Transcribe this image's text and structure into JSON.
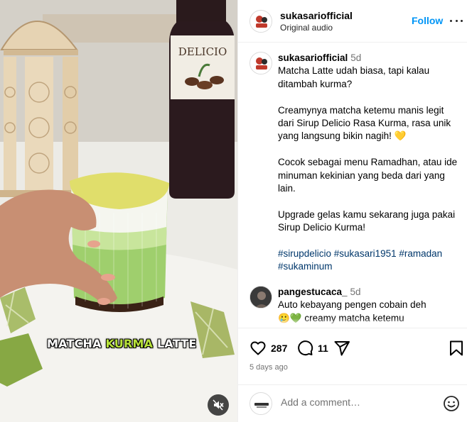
{
  "media": {
    "caption_prefix": "MATCHA",
    "caption_highlight": "KURMA",
    "caption_suffix": "LATTE",
    "bottle_label": "DELICIO",
    "mute_icon": "speaker-muted-icon"
  },
  "header": {
    "username": "sukasariofficial",
    "audio": "Original audio",
    "follow_label": "Follow",
    "more_icon": "more-horizontal-icon"
  },
  "caption": {
    "username": "sukasariofficial",
    "time": "5d",
    "lines": [
      "Matcha Latte udah biasa, tapi kalau ditambah kurma?",
      "Creamynya matcha ketemu manis legit dari Sirup Delicio Rasa Kurma, rasa unik yang langsung bikin nagih! 💛",
      "Cocok sebagai menu Ramadhan, atau ide minuman kekinian yang beda dari yang lain.",
      "Upgrade gelas kamu sekarang juga pakai Sirup Delicio Kurma!"
    ],
    "hashtags": "#sirupdelicio #sukasari1951 #ramadan #sukaminum"
  },
  "comment": {
    "username": "pangestucaca_",
    "time": "5d",
    "text": "Auto kebayang pengen cobain deh",
    "text2": "🥲💚 creamy matcha ketemu"
  },
  "actions": {
    "like_count": "287",
    "comment_count": "11",
    "timestamp": "5 days ago"
  },
  "add_comment": {
    "placeholder": "Add a comment…"
  },
  "colors": {
    "accent": "#0095f6",
    "hashtag": "#00376b",
    "highlight": "#b7e23a"
  }
}
